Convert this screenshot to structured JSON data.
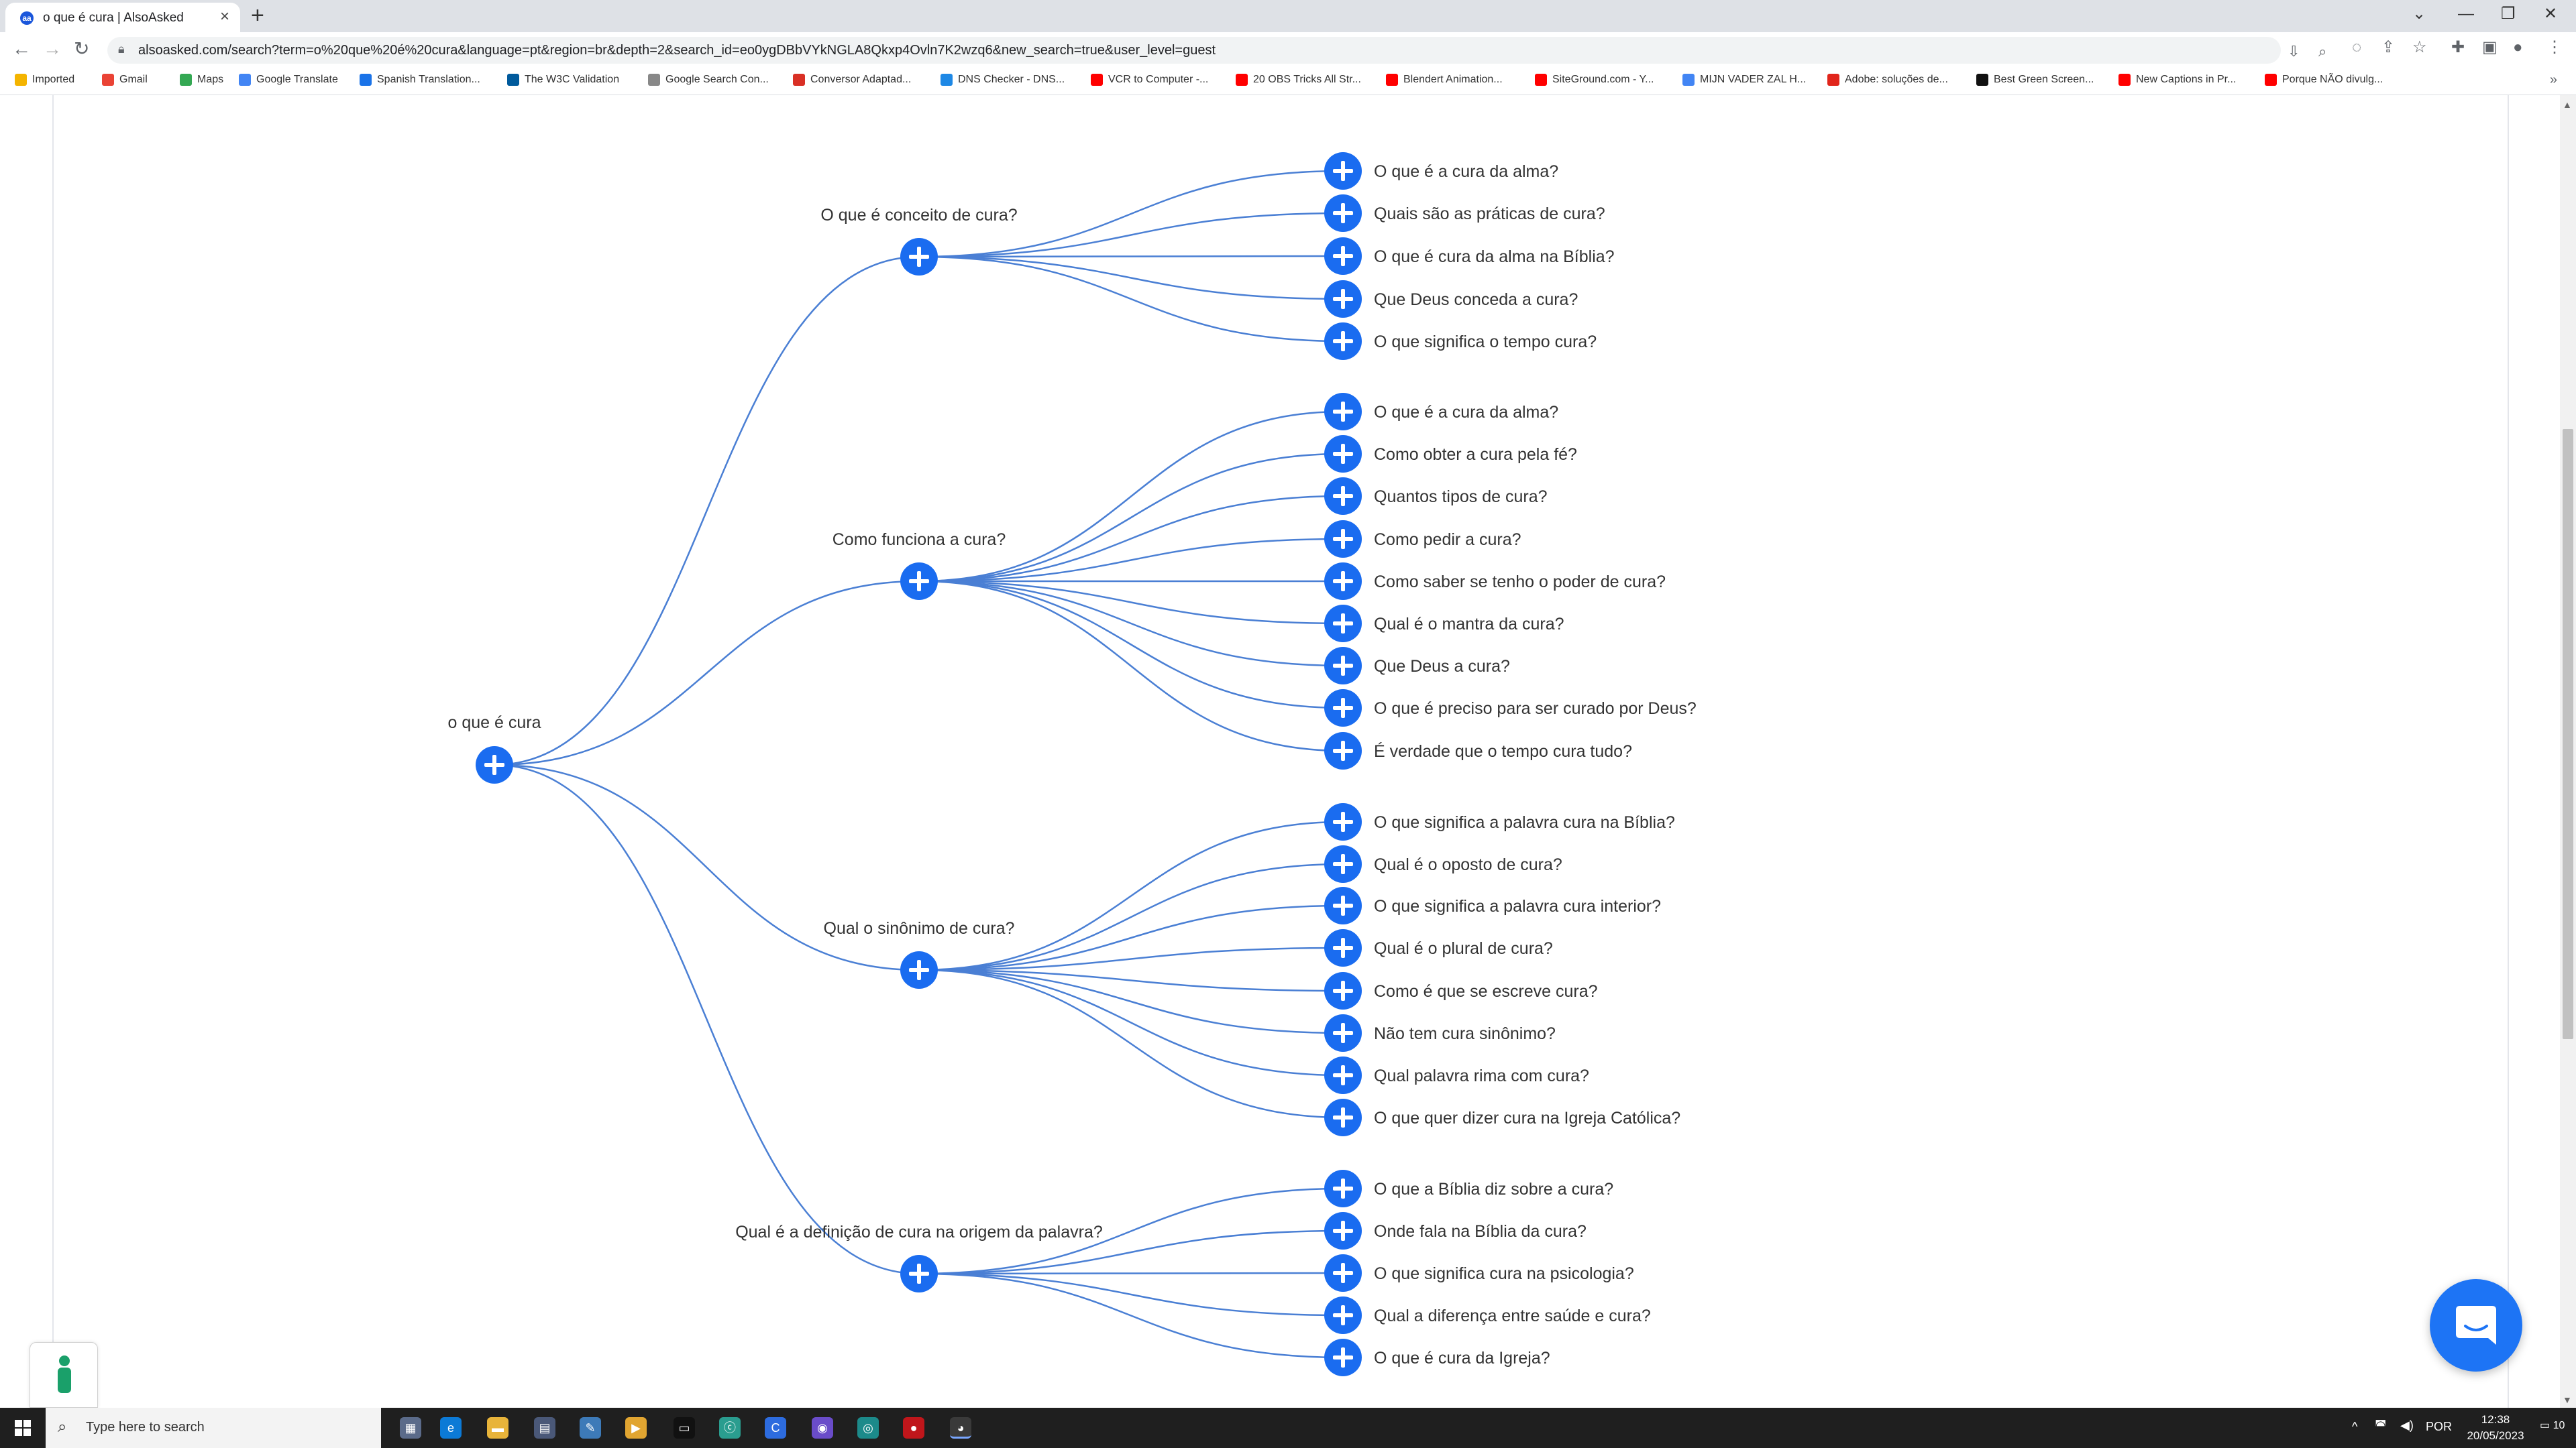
{
  "browser": {
    "tab_title": "o que é cura | AlsoAsked",
    "favicon_letter": "aa",
    "url": "alsoasked.com/search?term=o%20que%20é%20cura&language=pt&region=br&depth=2&search_id=eo0ygDBbVYkNGLA8Qkxp4Ovln7K2wzq6&new_search=true&user_level=guest",
    "bookmarks": [
      {
        "label": "Imported",
        "icon_color": "#f4b400"
      },
      {
        "label": "Gmail",
        "icon_color": "#ea4335"
      },
      {
        "label": "Maps",
        "icon_color": "#34a853"
      },
      {
        "label": "Google Translate",
        "icon_color": "#4285f4"
      },
      {
        "label": "Spanish Translation...",
        "icon_color": "#1a73e8"
      },
      {
        "label": "The W3C Validation",
        "icon_color": "#005a9c"
      },
      {
        "label": "Google Search Con...",
        "icon_color": "#888888"
      },
      {
        "label": "Conversor Adaptad...",
        "icon_color": "#d93025"
      },
      {
        "label": "DNS Checker - DNS...",
        "icon_color": "#1e88e5"
      },
      {
        "label": "VCR to Computer -...",
        "icon_color": "#ff0000"
      },
      {
        "label": "20 OBS Tricks All Str...",
        "icon_color": "#ff0000"
      },
      {
        "label": "Blendert Animation...",
        "icon_color": "#ff0000"
      },
      {
        "label": "SiteGround.com - Y...",
        "icon_color": "#ff0000"
      },
      {
        "label": "MIJN VADER ZAL H...",
        "icon_color": "#4285f4"
      },
      {
        "label": "Adobe: soluções de...",
        "icon_color": "#e1251b"
      },
      {
        "label": "Best Green Screen...",
        "icon_color": "#111111"
      },
      {
        "label": "New Captions in Pr...",
        "icon_color": "#ff0000"
      },
      {
        "label": "Porque NÃO divulg...",
        "icon_color": "#ff0000"
      }
    ]
  },
  "tree": {
    "root": "o que é cura",
    "branches": [
      {
        "label": "O que é conceito de cura?",
        "children": [
          "O que é a cura da alma?",
          "Quais são as práticas de cura?",
          "O que é cura da alma na Bíblia?",
          "Que Deus conceda a cura?",
          "O que significa o tempo cura?"
        ]
      },
      {
        "label": "Como funciona a cura?",
        "children": [
          "O que é a cura da alma?",
          "Como obter a cura pela fé?",
          "Quantos tipos de cura?",
          "Como pedir a cura?",
          "Como saber se tenho o poder de cura?",
          "Qual é o mantra da cura?",
          "Que Deus a cura?",
          "O que é preciso para ser curado por Deus?",
          "É verdade que o tempo cura tudo?"
        ]
      },
      {
        "label": "Qual o sinônimo de cura?",
        "children": [
          "O que significa a palavra cura na Bíblia?",
          "Qual é o oposto de cura?",
          "O que significa a palavra cura interior?",
          "Qual é o plural de cura?",
          "Como é que se escreve cura?",
          "Não tem cura sinônimo?",
          "Qual palavra rima com cura?",
          "O que quer dizer cura na Igreja Católica?"
        ]
      },
      {
        "label": "Qual é a definição de cura na origem da palavra?",
        "children": [
          "O que a Bíblia diz sobre a cura?",
          "Onde fala na Bíblia da cura?",
          "O que significa cura na psicologia?",
          "Qual a diferença entre saúde e cura?",
          "O que é cura da Igreja?"
        ]
      }
    ]
  },
  "colors": {
    "node_fill": "#1a6cf0",
    "link_stroke": "#4a7fd4",
    "label_text": "#333333"
  },
  "taskbar": {
    "search_placeholder": "Type here to search",
    "language": "POR",
    "time": "12:38",
    "date": "20/05/2023",
    "notification_count": "10"
  }
}
